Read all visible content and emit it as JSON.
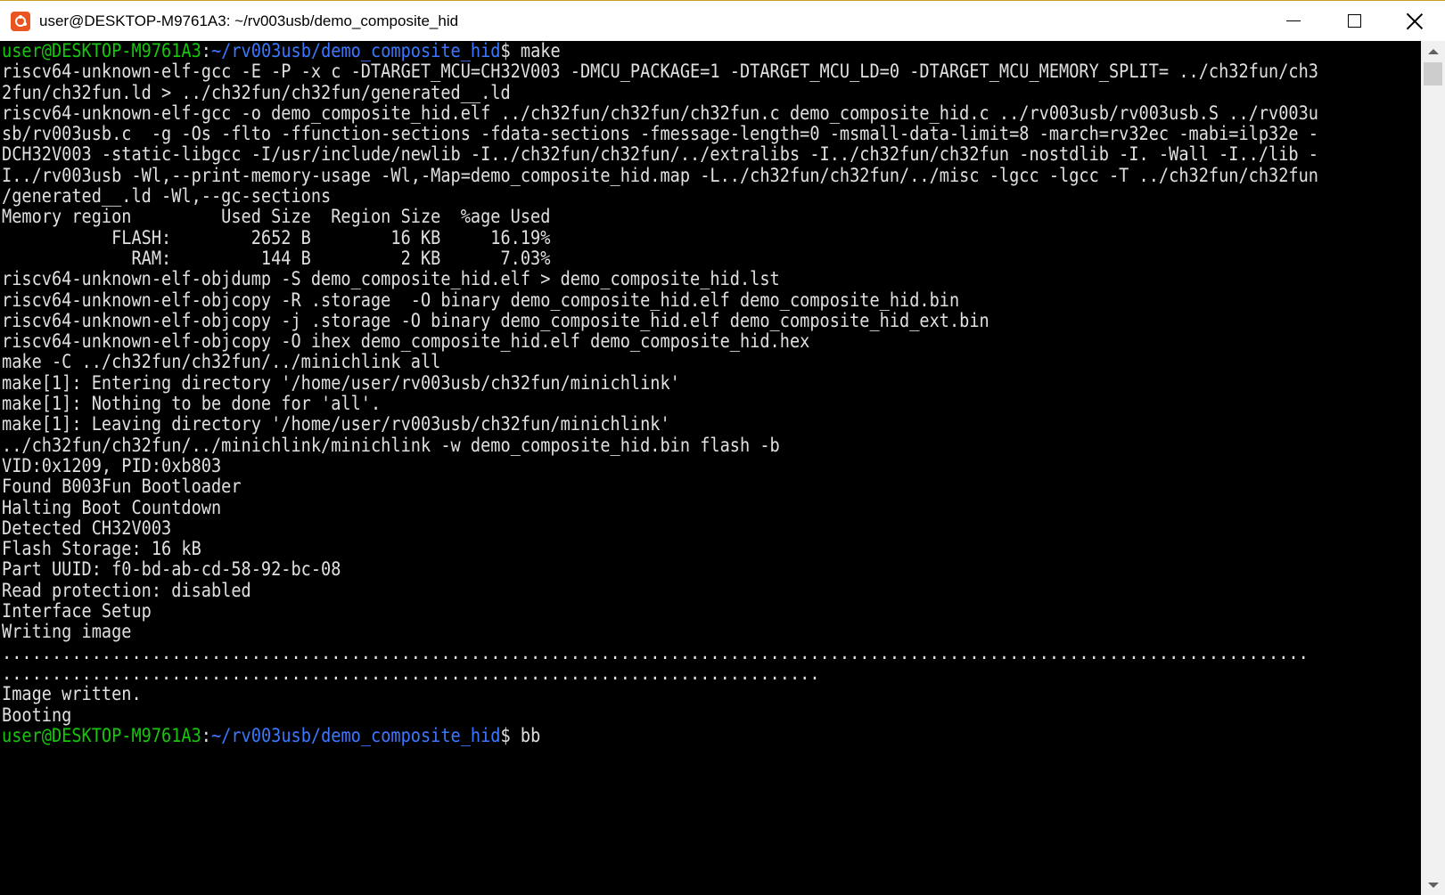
{
  "window": {
    "title": "user@DESKTOP-M9761A3: ~/rv003usb/demo_composite_hid",
    "controls": {
      "minimize": "minimize-icon",
      "maximize": "maximize-icon",
      "close": "close-icon"
    }
  },
  "colors": {
    "prompt_user": "#16c60c",
    "prompt_path": "#3b78ff",
    "text": "#e0e0e0",
    "background": "#000000"
  },
  "terminal": {
    "prompt_user_host": "user@DESKTOP-M9761A3",
    "prompt_colon": ":",
    "prompt_path": "~/rv003usb/demo_composite_hid",
    "prompt_symbol": "$ ",
    "first_command": "make",
    "last_command": "bb",
    "output_lines": [
      "riscv64-unknown-elf-gcc -E -P -x c -DTARGET_MCU=CH32V003 -DMCU_PACKAGE=1 -DTARGET_MCU_LD=0 -DTARGET_MCU_MEMORY_SPLIT= ../ch32fun/ch3",
      "2fun/ch32fun.ld > ../ch32fun/ch32fun/generated__.ld",
      "riscv64-unknown-elf-gcc -o demo_composite_hid.elf ../ch32fun/ch32fun/ch32fun.c demo_composite_hid.c ../rv003usb/rv003usb.S ../rv003u",
      "sb/rv003usb.c  -g -Os -flto -ffunction-sections -fdata-sections -fmessage-length=0 -msmall-data-limit=8 -march=rv32ec -mabi=ilp32e -",
      "DCH32V003 -static-libgcc -I/usr/include/newlib -I../ch32fun/ch32fun/../extralibs -I../ch32fun/ch32fun -nostdlib -I. -Wall -I../lib -",
      "I../rv003usb -Wl,--print-memory-usage -Wl,-Map=demo_composite_hid.map -L../ch32fun/ch32fun/../misc -lgcc -lgcc -T ../ch32fun/ch32fun",
      "/generated__.ld -Wl,--gc-sections",
      "Memory region         Used Size  Region Size  %age Used",
      "           FLASH:        2652 B        16 KB     16.19%",
      "             RAM:         144 B         2 KB      7.03%",
      "riscv64-unknown-elf-objdump -S demo_composite_hid.elf > demo_composite_hid.lst",
      "riscv64-unknown-elf-objcopy -R .storage  -O binary demo_composite_hid.elf demo_composite_hid.bin",
      "riscv64-unknown-elf-objcopy -j .storage -O binary demo_composite_hid.elf demo_composite_hid_ext.bin",
      "riscv64-unknown-elf-objcopy -O ihex demo_composite_hid.elf demo_composite_hid.hex",
      "make -C ../ch32fun/ch32fun/../minichlink all",
      "make[1]: Entering directory '/home/user/rv003usb/ch32fun/minichlink'",
      "make[1]: Nothing to be done for 'all'.",
      "make[1]: Leaving directory '/home/user/rv003usb/ch32fun/minichlink'",
      "../ch32fun/ch32fun/../minichlink/minichlink -w demo_composite_hid.bin flash -b",
      "VID:0x1209, PID:0xb803",
      "Found B003Fun Bootloader",
      "Halting Boot Countdown",
      "Detected CH32V003",
      "Flash Storage: 16 kB",
      "Part UUID: f0-bd-ab-cd-58-92-bc-08",
      "Read protection: disabled",
      "Interface Setup",
      "Writing image",
      "...................................................................................................................................",
      "..................................................................................",
      "Image written.",
      "Booting"
    ]
  },
  "scrollbar": {
    "up_icon": "scroll-up-arrow-icon",
    "down_icon": "scroll-down-arrow-icon"
  }
}
